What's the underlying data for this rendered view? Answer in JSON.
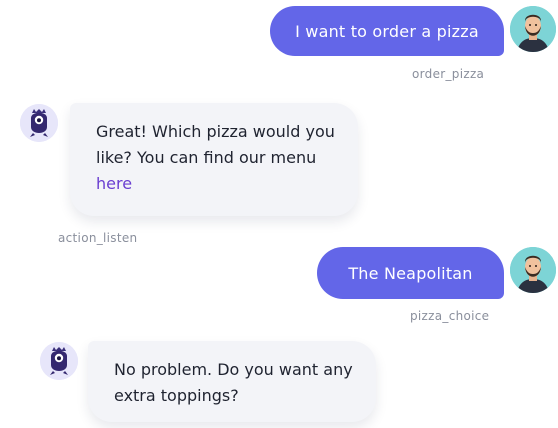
{
  "messages": [
    {
      "sender": "user",
      "text": "I want to order a pizza",
      "tag": "order_pizza"
    },
    {
      "sender": "bot",
      "text_before_link": "Great! Which pizza would you like? You can find our menu ",
      "link_text": "here",
      "tag": "action_listen"
    },
    {
      "sender": "user",
      "text": "The Neapolitan",
      "tag": "pizza_choice"
    },
    {
      "sender": "bot",
      "text": "No problem. Do you want any extra toppings?"
    }
  ],
  "icons": {
    "user_avatar": "bearded-man-avatar-icon",
    "bot_avatar": "purple-owl-bot-icon"
  },
  "colors": {
    "user_bubble": "#6366e8",
    "bot_bubble": "#f3f4f8",
    "link": "#6a3fd1",
    "user_avatar_bg": "#7dd4d6",
    "bot_avatar_bg": "#e7e6fa",
    "tag_text": "#8a8f9c"
  }
}
